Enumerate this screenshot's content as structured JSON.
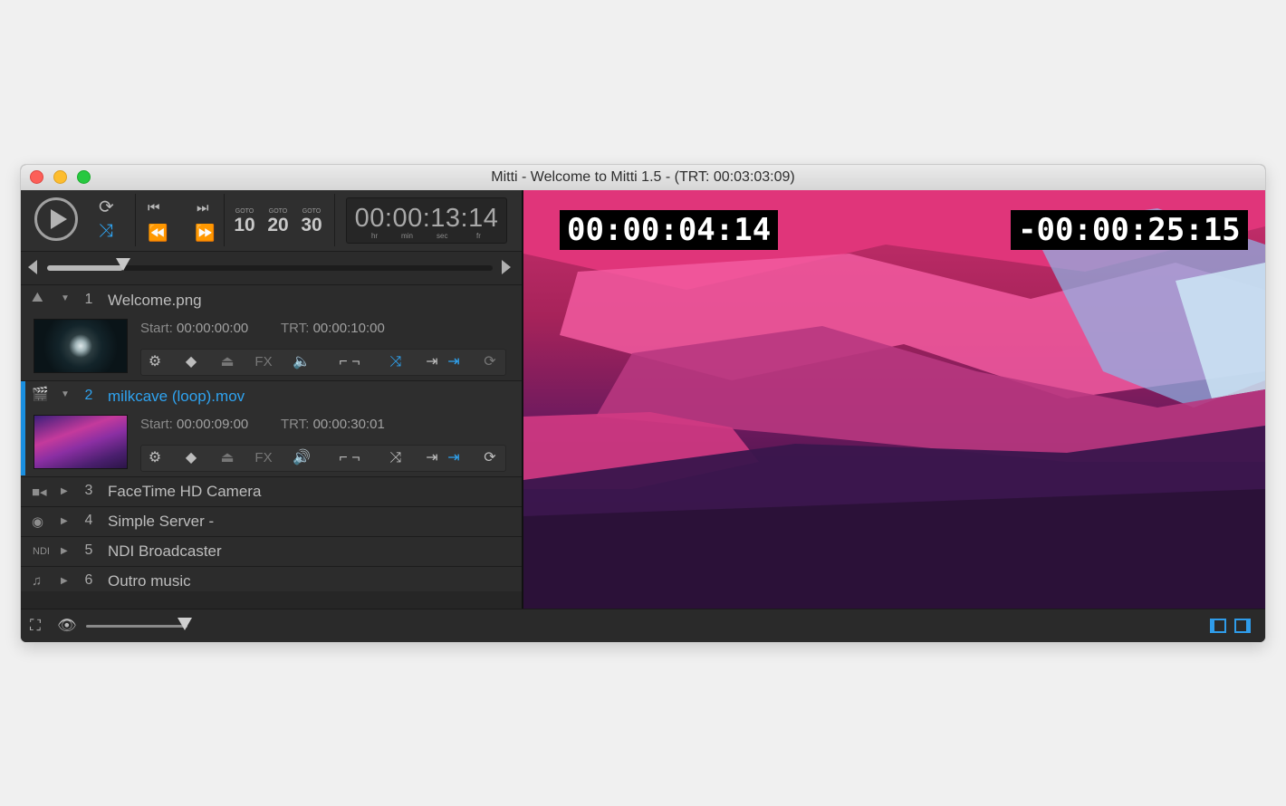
{
  "window": {
    "title": "Mitti - Welcome to Mitti 1.5 - (TRT: 00:03:03:09)"
  },
  "transport": {
    "goto": [
      {
        "label": "GOTO",
        "value": "10"
      },
      {
        "label": "GOTO",
        "value": "20"
      },
      {
        "label": "GOTO",
        "value": "30"
      }
    ],
    "timecode": "00:00:13:14",
    "units": [
      "hr",
      "min",
      "sec",
      "fr"
    ],
    "scrub_progress": 0.17
  },
  "playlist": [
    {
      "index": "1",
      "name": "Welcome.png",
      "icon": "image-icon",
      "expanded": true,
      "active": false,
      "start_label": "Start:",
      "start": "00:00:00:00",
      "trt_label": "TRT:",
      "trt": "00:00:10:00"
    },
    {
      "index": "2",
      "name": "milkcave (loop).mov",
      "icon": "movie-icon",
      "expanded": true,
      "active": true,
      "start_label": "Start:",
      "start": "00:00:09:00",
      "trt_label": "TRT:",
      "trt": "00:00:30:01"
    },
    {
      "index": "3",
      "name": "FaceTime HD Camera",
      "icon": "camera-icon"
    },
    {
      "index": "4",
      "name": "Simple Server -",
      "icon": "syphon-icon"
    },
    {
      "index": "5",
      "name": "NDI Broadcaster",
      "icon": "ndi-icon",
      "icon_text": "NDI"
    },
    {
      "index": "6",
      "name": "Outro music",
      "icon": "music-icon"
    }
  ],
  "toolbar": {
    "fx_label": "FX"
  },
  "output": {
    "elapsed": "00:00:04:14",
    "remaining": "-00:00:25:15"
  },
  "bottom": {
    "volume": 0.9
  },
  "colors": {
    "accent": "#2fa3f0",
    "panel": "#2b2b2b",
    "titlebar": "#e1e1e1"
  }
}
